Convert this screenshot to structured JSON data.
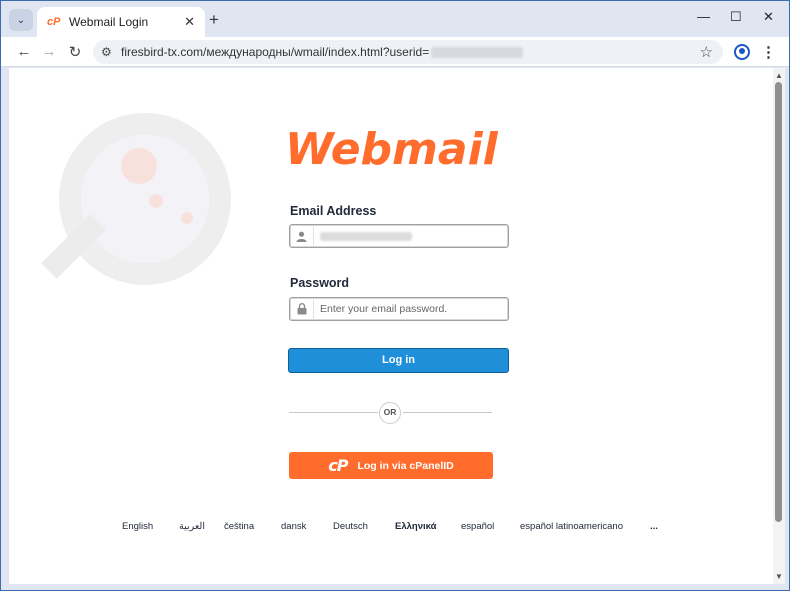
{
  "browser": {
    "tab_title": "Webmail Login",
    "tab_favicon": "cP",
    "url": "firesbird-tx.com/международны/wmail/index.html?userid=",
    "icons": {
      "tab_menu": "chevron-down-icon",
      "close": "close-icon",
      "new_tab": "plus-icon",
      "back": "arrow-left-icon",
      "forward": "arrow-right-icon",
      "reload": "reload-icon",
      "site_info": "tune-icon",
      "bookmark": "star-icon",
      "profile": "profile-icon",
      "menu": "kebab-icon"
    },
    "glyphs": {
      "tab_menu": "⌄",
      "tab_close": "✕",
      "new_tab": "+",
      "minimize": "—",
      "maximize": "☐",
      "close_window": "✕",
      "back": "←",
      "forward": "→",
      "reload": "↻",
      "site_info": "⚙",
      "star": "☆",
      "kebab": "⋮"
    }
  },
  "page": {
    "logo": "Webmail",
    "email": {
      "label": "Email Address",
      "value": ""
    },
    "password": {
      "label": "Password",
      "placeholder": "Enter your email password."
    },
    "login_button": "Log in",
    "or_text": "OR",
    "cpanel_button": "Log in via cPanelID",
    "cpanel_logo": "cP",
    "languages": [
      "English",
      "العربية",
      "čeština",
      "dansk",
      "Deutsch",
      "Ελληνικά",
      "español",
      "español latinoamericano",
      "..."
    ]
  },
  "colors": {
    "accent_orange": "#ff6c2c",
    "login_blue": "#1e8fd8",
    "frame_blue": "#3c6db0"
  }
}
